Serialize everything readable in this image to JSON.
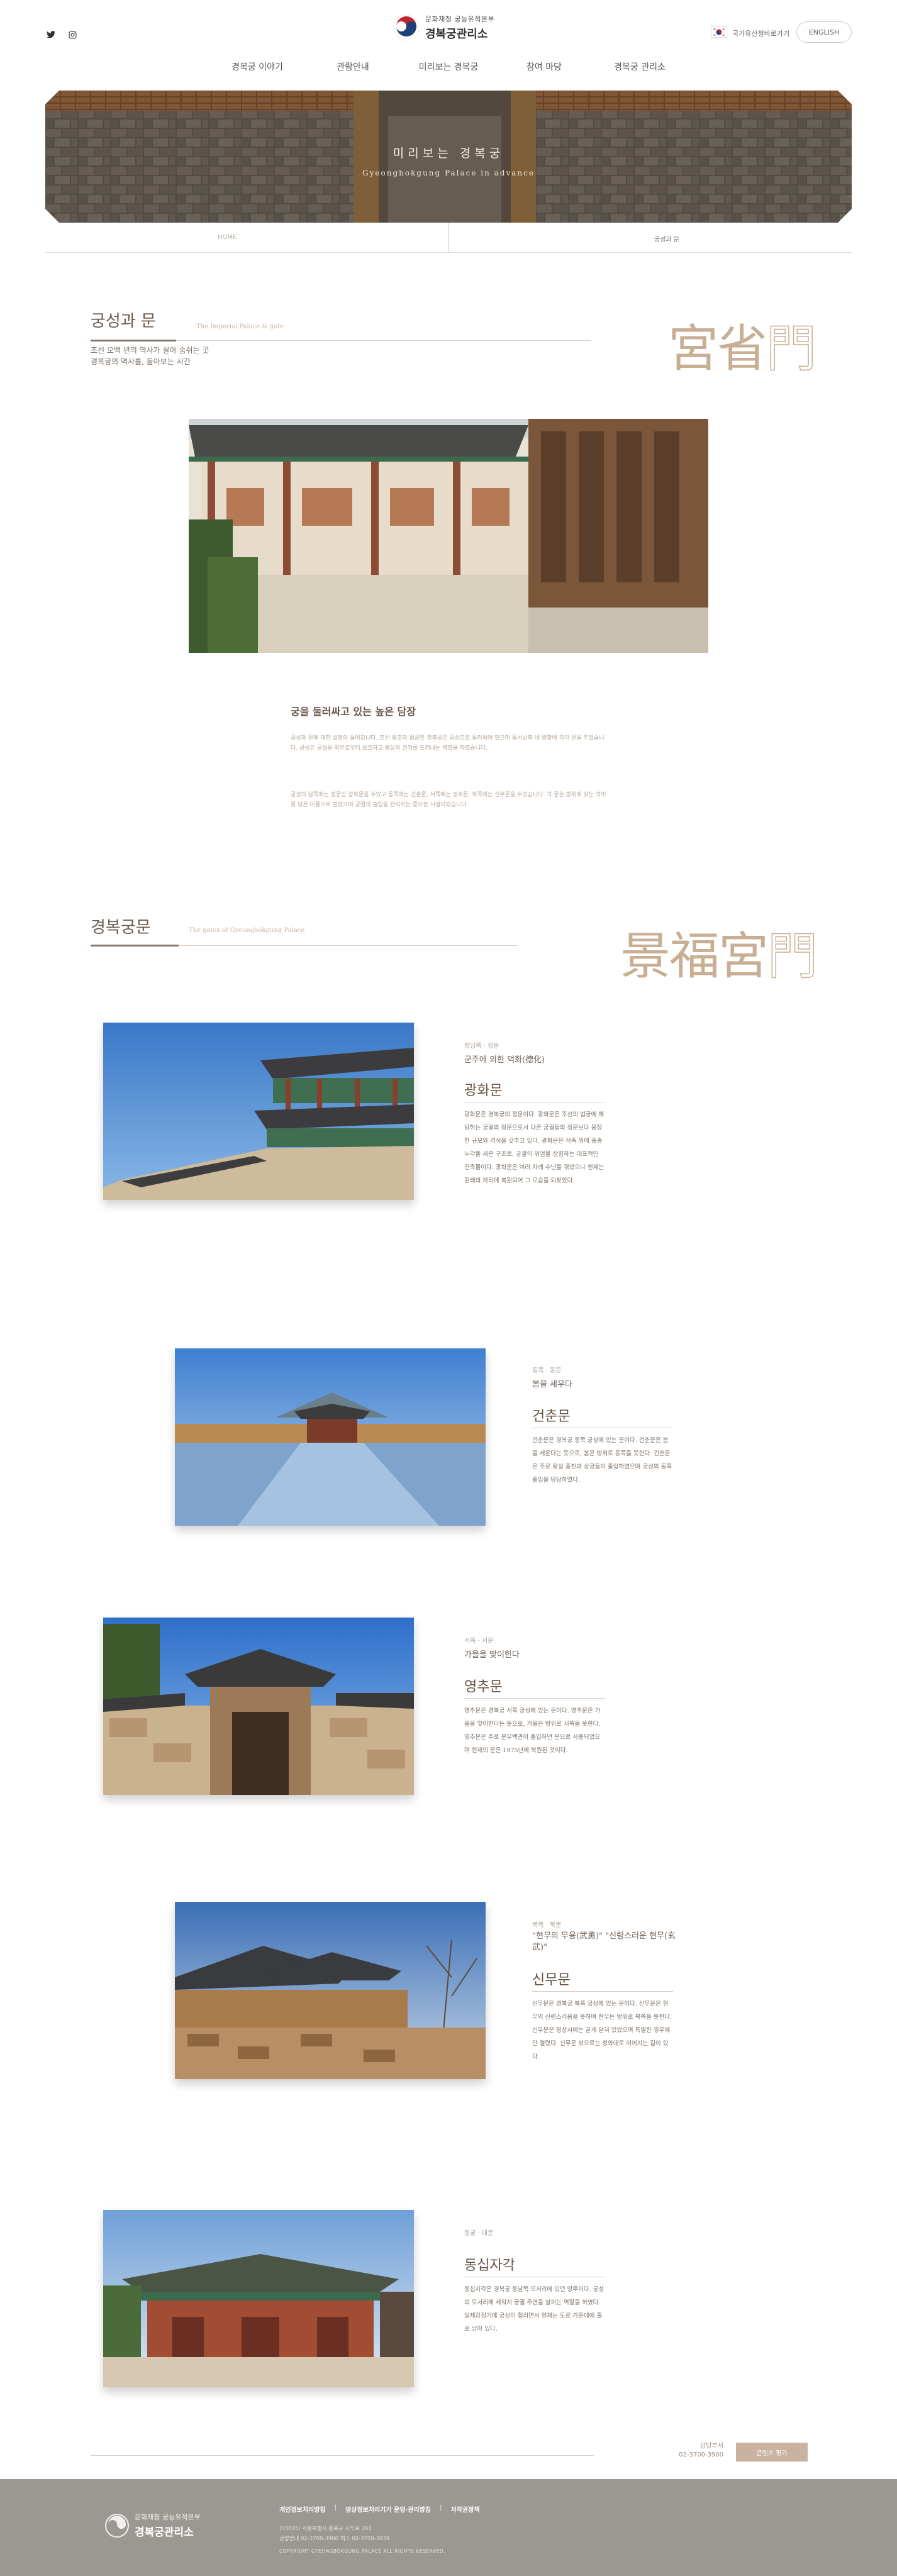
{
  "header": {
    "logo_sub": "문화재청 궁능유적본부",
    "logo_main": "경복궁관리소",
    "lang_link": "국가유산청바로가기",
    "eng_button": "ENGLISH",
    "social": [
      "twitter-icon",
      "instagram-icon"
    ]
  },
  "gnb": [
    "경복궁 이야기",
    "관람안내",
    "미리보는 경복궁",
    "참여 마당",
    "경복궁 관리소"
  ],
  "hero": {
    "title": "미리보는 경복궁",
    "subtitle": "Gyeongbokgung Palace in advance"
  },
  "location": {
    "home": "HOME",
    "current": "궁성과 문"
  },
  "section1": {
    "title": "궁성과 문",
    "en": "The Imperial Palace & gate",
    "desc": [
      "조선 오백 년의 역사가 살아 숨쉬는 곳",
      "경복궁의 역사를, 돌아보는 시간"
    ],
    "hanja": "宮省",
    "hanja_outline": "門",
    "block_heading": "궁을 둘러싸고 있는 높은 담장",
    "block_para1": "궁성과 문에 대한 설명이 들어갑니다. 조선 왕조의 법궁인 경복궁은 궁성으로 둘러싸여 있으며 동서남북 네 방향에 각각 문을 두었습니다. 궁성은 궁궐을 외부로부터 보호하고 왕실의 권위를 드러내는 역할을 하였습니다.",
    "block_para2": "궁성의 남쪽에는 정문인 광화문을 두었고 동쪽에는 건춘문, 서쪽에는 영추문, 북쪽에는 신무문을 두었습니다. 각 문은 방위에 맞는 의미를 담은 이름으로 불렸으며 궁궐의 출입을 관리하는 중요한 시설이었습니다."
  },
  "section2": {
    "title": "경복궁문",
    "en": "The gates of Gyeongbokgung Palace",
    "hanja": "景福宮",
    "hanja_outline": "門"
  },
  "gates": [
    {
      "meta": "정남쪽 · 정문",
      "tag": "군주에 의한 덕화(德化)",
      "name": "광화문",
      "desc": "광화문은 경복궁의 정문이다. 광화문은 조선의 법궁에 해당하는 궁궐의 정문으로서 다른 궁궐들의 정문보다 웅장한 규모와 격식을 갖추고 있다. 광화문은 석축 위에 중층 누각을 세운 구조로, 궁궐의 위엄을 상징하는 대표적인 건축물이다. 광화문은 여러 차례 수난을 겪었으나 현재는 원래의 자리에 복원되어 그 모습을 되찾았다."
    },
    {
      "meta": "동쪽 · 동문",
      "tag": "봄을 세우다",
      "name": "건춘문",
      "desc": "건춘문은 경복궁 동쪽 궁성에 있는 문이다. 건춘문은 봄을 세운다는 뜻으로, 봄은 방위로 동쪽을 뜻한다. 건춘문은 주로 왕실 종친과 상궁들이 출입하였으며 궁성의 동쪽 출입을 담당하였다."
    },
    {
      "meta": "서쪽 · 서문",
      "tag": "가을을 맞이한다",
      "name": "영추문",
      "desc": "영추문은 경복궁 서쪽 궁성에 있는 문이다. 영추문은 가을을 맞이한다는 뜻으로, 가을은 방위로 서쪽을 뜻한다. 영추문은 주로 문무백관이 출입하던 문으로 사용되었으며 현재의 문은 1975년에 복원된 것이다."
    },
    {
      "meta": "북쪽 · 북문",
      "tag": "\"현무의 무용(武勇)\" \"신령스러운 현무(玄武)\"",
      "name": "신무문",
      "desc": "신무문은 경복궁 북쪽 궁성에 있는 문이다. 신무문은 현무의 신령스러움을 뜻하며 현무는 방위로 북쪽을 뜻한다. 신무문은 평상시에는 굳게 닫혀 있었으며 특별한 경우에만 열렸다. 신무문 밖으로는 청와대로 이어지는 길이 있다."
    },
    {
      "meta": "동궁 · 대문",
      "tag": "",
      "name": "동십자각",
      "desc": "동십자각은 경복궁 동남쪽 모서리에 있던 망루이다. 궁성의 모서리에 세워져 궁궐 주변을 살피는 역할을 하였다. 일제강점기에 궁성이 헐리면서 현재는 도로 가운데에 홀로 남아 있다."
    }
  ],
  "bottom": {
    "inquiry_label": "담당부서",
    "inquiry_phone": "02-3700-3900",
    "button": "콘텐츠 평가"
  },
  "footer": {
    "logo_sub": "문화재청 궁능유적본부",
    "logo_main": "경복궁관리소",
    "links": [
      "개인정보처리방침",
      "|",
      "영상정보처리기기 운영·관리방침",
      "|",
      "저작권정책"
    ],
    "address": "(03045) 서울특별시 종로구 사직로 161",
    "contact": "관람안내 02-3700-3900 팩스 02-3700-3939",
    "copyright": "COPYRIGHT GYEONGBOKGUNG PALACE ALL RIGHTS RESERVED."
  },
  "colors": {
    "accent": "#c9b3a0",
    "title_brown": "#6a5345",
    "hanja": "#c8ae93",
    "footer_bg": "#9b9893"
  }
}
